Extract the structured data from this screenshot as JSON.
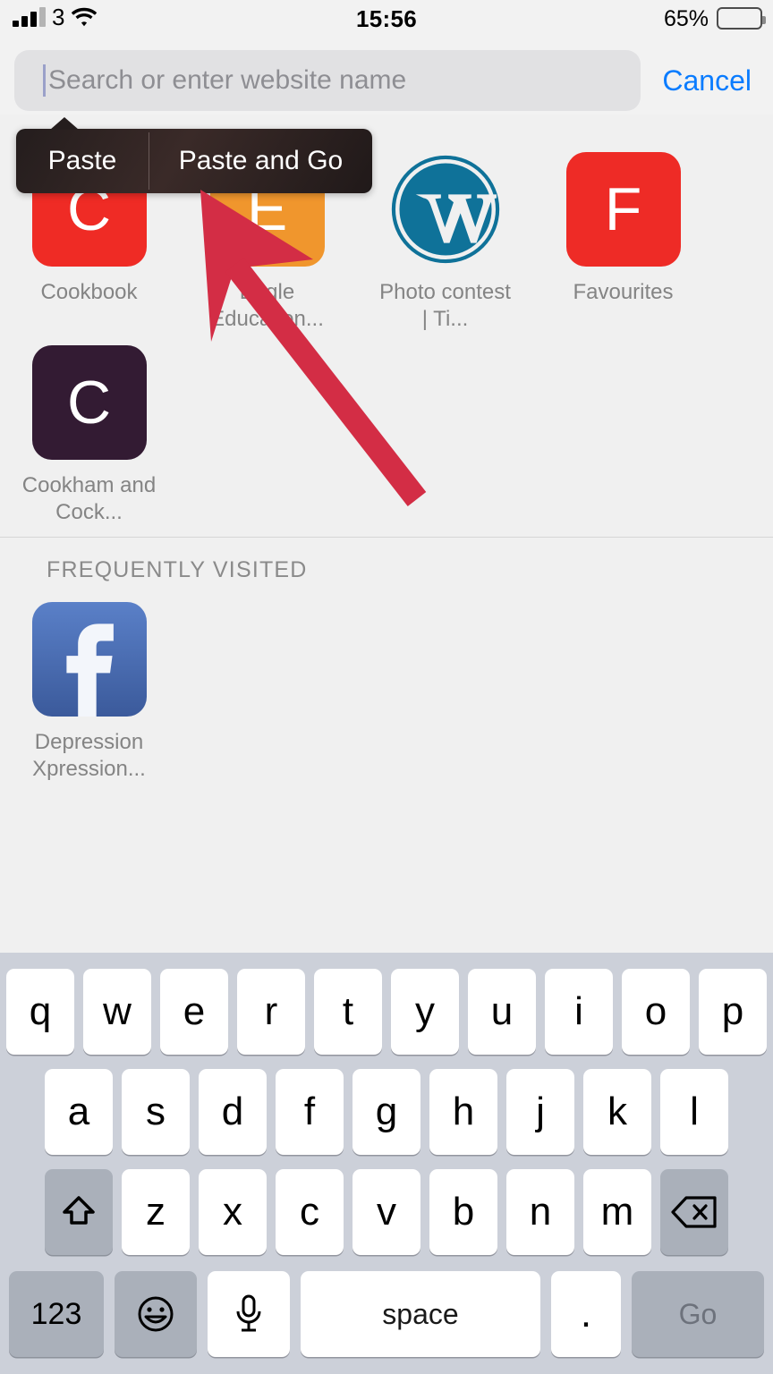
{
  "status_bar": {
    "carrier": "3",
    "time": "15:56",
    "battery_percent": "65%",
    "battery_level": 65,
    "signal_bars": 3,
    "wifi_icon": "wifi-icon"
  },
  "search": {
    "placeholder": "Search or enter website name",
    "value": "",
    "cancel_label": "Cancel"
  },
  "context_menu": {
    "paste_label": "Paste",
    "paste_and_go_label": "Paste and Go"
  },
  "favorites": {
    "items": [
      {
        "label": "Cookbook",
        "icon_type": "letter",
        "letter": "C",
        "color": "#ef2b25",
        "text_color": "#ffffff"
      },
      {
        "label": "Eagle Education...",
        "icon_type": "letter",
        "letter": "E",
        "color": "#f0962d",
        "text_color": "#ffffff"
      },
      {
        "label": "Photo contest | Ti...",
        "icon_type": "wordpress-logo",
        "letter": "",
        "color": "#0f7299",
        "text_color": "#ffffff"
      },
      {
        "label": "Favourites",
        "icon_type": "letter",
        "letter": "F",
        "color": "#ee2b26",
        "text_color": "#ffffff"
      },
      {
        "label": "Cookham and Cock...",
        "icon_type": "letter",
        "letter": "C",
        "color": "#331b33",
        "text_color": "#ffffff"
      }
    ]
  },
  "frequently_visited": {
    "header": "FREQUENTLY VISITED",
    "items": [
      {
        "label": "Depression Xpression...",
        "icon_type": "facebook-logo",
        "color": "#3b5a9b"
      }
    ]
  },
  "keyboard": {
    "row1": [
      "q",
      "w",
      "e",
      "r",
      "t",
      "y",
      "u",
      "i",
      "o",
      "p"
    ],
    "row2": [
      "a",
      "s",
      "d",
      "f",
      "g",
      "h",
      "j",
      "k",
      "l"
    ],
    "row3": [
      "z",
      "x",
      "c",
      "v",
      "b",
      "n",
      "m"
    ],
    "shift_key": "shift-icon",
    "backspace_key": "backspace-icon",
    "numbers_key": "123",
    "emoji_key": "emoji-icon",
    "dictation_key": "microphone-icon",
    "space_key": "space",
    "period_key": ".",
    "go_key": "Go"
  },
  "annotation": {
    "arrow_color": "#d32d45",
    "arrow_points_to": "Paste and Go"
  },
  "colors": {
    "background": "#f0f0f0",
    "accent_blue": "#0a7cff",
    "keyboard_background": "#ccd0d9",
    "key_white": "#ffffff",
    "key_gray": "#aab0ba"
  }
}
